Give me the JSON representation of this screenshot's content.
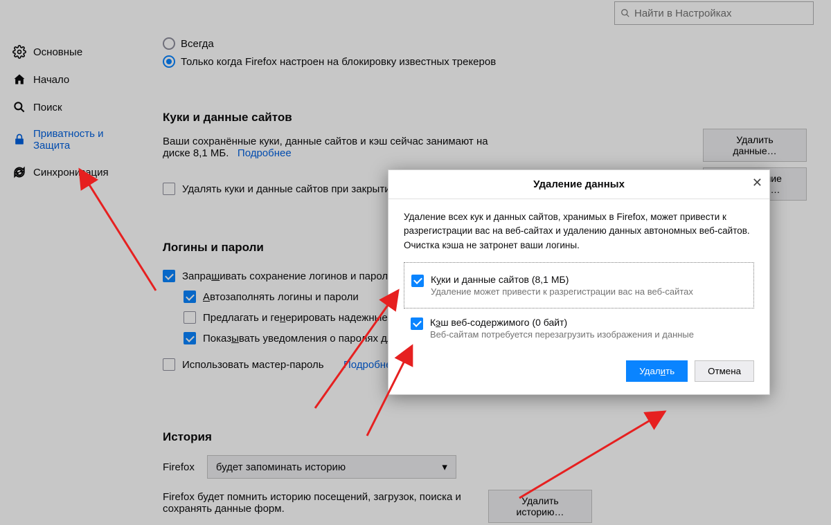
{
  "search": {
    "placeholder": "Найти в Настройках"
  },
  "sidebar": {
    "items": [
      {
        "label": "Основные"
      },
      {
        "label": "Начало"
      },
      {
        "label": "Поиск"
      },
      {
        "label": "Приватность и Защита"
      },
      {
        "label": "Синхронизация"
      }
    ]
  },
  "tracking": {
    "always": "Всегда",
    "only_known": "Только когда Firefox настроен на блокировку известных трекеров"
  },
  "cookies": {
    "title": "Куки и данные сайтов",
    "desc_prefix": "Ваши сохранённые куки, данные сайтов и кэш сейчас занимают на диске 8,1 МБ.",
    "more": "Подробнее",
    "delete_btn": "Удалить данные…",
    "manage_btn": "Управление данными…",
    "clear_on_close": "Удалять куки и данные сайтов при закрытии"
  },
  "logins": {
    "title": "Логины и пароли",
    "ask_save": "Запрашивать сохранение логинов и паролей",
    "autofill": "Автозаполнять логины и пароли",
    "suggest": "Предлагать и генерировать надежные",
    "notify": "Показывать уведомления о паролях для",
    "master": "Использовать мастер-пароль",
    "more": "Подробнее"
  },
  "history": {
    "title": "История",
    "firefox_label": "Firefox",
    "mode": "будет запоминать историю",
    "desc": "Firefox будет помнить историю посещений, загрузок, поиска и сохранять данные форм.",
    "clear_btn": "Удалить историю…"
  },
  "modal": {
    "title": "Удаление данных",
    "text": "Удаление всех кук и данных сайтов, хранимых в Firefox, может привести к разрегистрации вас на веб-сайтах и удалению данных автономных веб-сайтов. Очистка кэша не затронет ваши логины.",
    "opt1_label_pre": "К",
    "opt1_label_u": "у",
    "opt1_label_post": "ки и данные сайтов (8,1 МБ)",
    "opt1_desc": "Удаление может привести к разрегистрации вас на веб-сайтах",
    "opt2_label_pre": "К",
    "opt2_label_u": "э",
    "opt2_label_post": "ш веб-содержимого (0 байт)",
    "opt2_desc": "Веб-сайтам потребуется перезагрузить изображения и данные",
    "delete_pre": "Удал",
    "delete_u": "и",
    "delete_post": "ть",
    "cancel": "Отмена"
  }
}
